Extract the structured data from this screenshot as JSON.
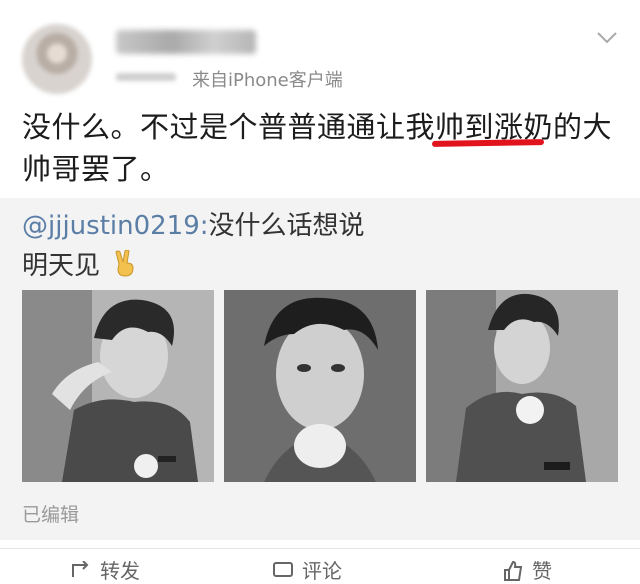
{
  "post": {
    "source": "来自iPhone客户端",
    "text": "没什么。不过是个普普通通让我帅到涨奶的大帅哥罢了。"
  },
  "retweet": {
    "author": "@jjjustin0219:",
    "text_line1": "没什么话想说",
    "text_line2": "明天见",
    "edited": "已编辑"
  },
  "actions": {
    "repost": "转发",
    "comment": "评论",
    "like": "赞"
  },
  "colors": {
    "highlight": "#e1131c",
    "link": "#5b7ea6",
    "retweet_bg": "#f3f3f3"
  }
}
